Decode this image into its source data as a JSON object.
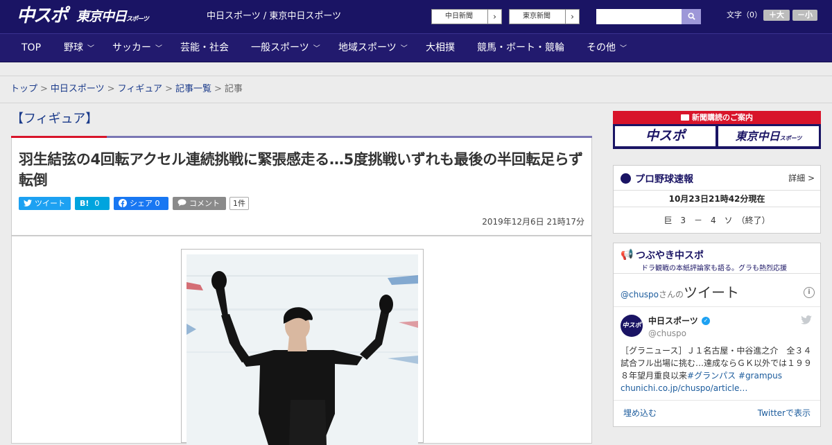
{
  "header": {
    "logo_chuspo": "中スポ",
    "logo_tokyo": "東京中日",
    "logo_tokyo_small": "スポーツ",
    "site_name": "中日スポーツ / 東京中日スポーツ",
    "btn_chunichi": "中日新聞",
    "btn_tokyo": "東京新聞",
    "font_size_label": "文字（0）",
    "font_bigger": "＋大",
    "font_smaller": "－小"
  },
  "nav": {
    "items": [
      "TOP",
      "野球",
      "サッカー",
      "芸能・社会",
      "一般スポーツ",
      "地域スポーツ",
      "大相撲",
      "競馬・ボート・競輪",
      "その他"
    ]
  },
  "breadcrumb": [
    "トップ",
    "中日スポーツ",
    "フィギュア",
    "記事一覧",
    "記事"
  ],
  "article": {
    "category": "【フィギュア】",
    "title": "羽生結弦の4回転アクセル連続挑戦に緊張感走る…5度挑戦いずれも最後の半回転足らず転倒",
    "share": {
      "tweet": "ツイート",
      "hatena": "B!",
      "hatena_count": "0",
      "facebook": "シェア 0",
      "comment": "コメント",
      "comment_count": "1件"
    },
    "date": "2019年12月6日 21時17分"
  },
  "sidebar": {
    "ad_header": "新聞購読のご案内",
    "ad_chuspo": "中スポ",
    "ad_tokyo": "東京中日",
    "ad_tokyo_small": "スポーツ",
    "baseball": {
      "title": "プロ野球速報",
      "detail": "詳細 >",
      "time": "10月23日21時42分現在",
      "score": "巨　3　－　4　ソ　（終了）"
    },
    "tsubuyaki": {
      "title": "つぶやき中スポ",
      "subtitle": "ドラ観戦の本紙評論家も語る。グラも熱烈応援",
      "handle": "@chuspo",
      "san_no": "さんの",
      "tweets_label": "ツイート",
      "info": "i",
      "account_name": "中日スポーツ",
      "account_handle": "@chuspo",
      "tweet_text": "［グラニュース］Ｊ１名古屋・中谷進之介　全３４試合フル出場に挑む…達成ならＧＫ以外では１９９８年望月重良以来",
      "tweet_hashtags": "#グランパス #grampus",
      "tweet_link": "chunichi.co.jp/chuspo/article…",
      "embed": "埋め込む",
      "view_on_twitter": "Twitterで表示"
    }
  },
  "colors": {
    "header_bg": "#1a1464",
    "accent_red": "#d8142a",
    "link_blue": "#1a3a8a",
    "twitter": "#1da1f2",
    "hatena": "#00a4de",
    "facebook": "#1877f2"
  }
}
